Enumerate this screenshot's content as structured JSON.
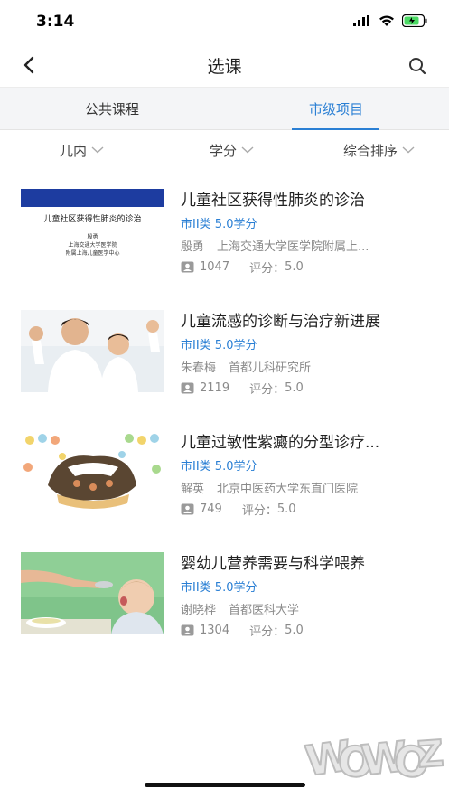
{
  "status_bar": {
    "time": "3:14"
  },
  "header": {
    "title": "选课"
  },
  "tabs": [
    {
      "label": "公共课程"
    },
    {
      "label": "市级项目"
    }
  ],
  "filters": [
    {
      "label": "儿内"
    },
    {
      "label": "学分"
    },
    {
      "label": "综合排序"
    }
  ],
  "courses": [
    {
      "title": "儿童社区获得性肺炎的诊治",
      "credit": "市II类 5.0学分",
      "teacher": "殷勇",
      "org": "上海交通大学医学院附属上...",
      "views": "1047",
      "rating_label": "评分：",
      "rating": "5.0",
      "thumb_text": {
        "title": "儿童社区获得性肺炎的诊治",
        "line1": "殷勇",
        "line2": "上海交通大学医学院",
        "line3": "附属上海儿童医学中心"
      }
    },
    {
      "title": "儿童流感的诊断与治疗新进展",
      "credit": "市II类 5.0学分",
      "teacher": "朱春梅",
      "org": "首都儿科研究所",
      "views": "2119",
      "rating_label": "评分：",
      "rating": "5.0"
    },
    {
      "title": "儿童过敏性紫癜的分型诊疗...",
      "credit": "市II类 5.0学分",
      "teacher": "解英",
      "org": "北京中医药大学东直门医院",
      "views": "749",
      "rating_label": "评分：",
      "rating": "5.0"
    },
    {
      "title": "婴幼儿营养需要与科学喂养",
      "credit": "市II类 5.0学分",
      "teacher": "谢晓桦",
      "org": "首都医科大学",
      "views": "1304",
      "rating_label": "评分：",
      "rating": "5.0"
    }
  ],
  "watermark": {
    "text": "WOWOZ"
  },
  "colors": {
    "accent": "#2a7fd4",
    "tab_bg": "#f4f5f7",
    "muted": "#8a8a8a"
  },
  "icons": [
    "back-icon",
    "search-icon",
    "chevron-down-icon",
    "views-icon",
    "wifi-icon",
    "battery-icon",
    "signal-icon"
  ]
}
